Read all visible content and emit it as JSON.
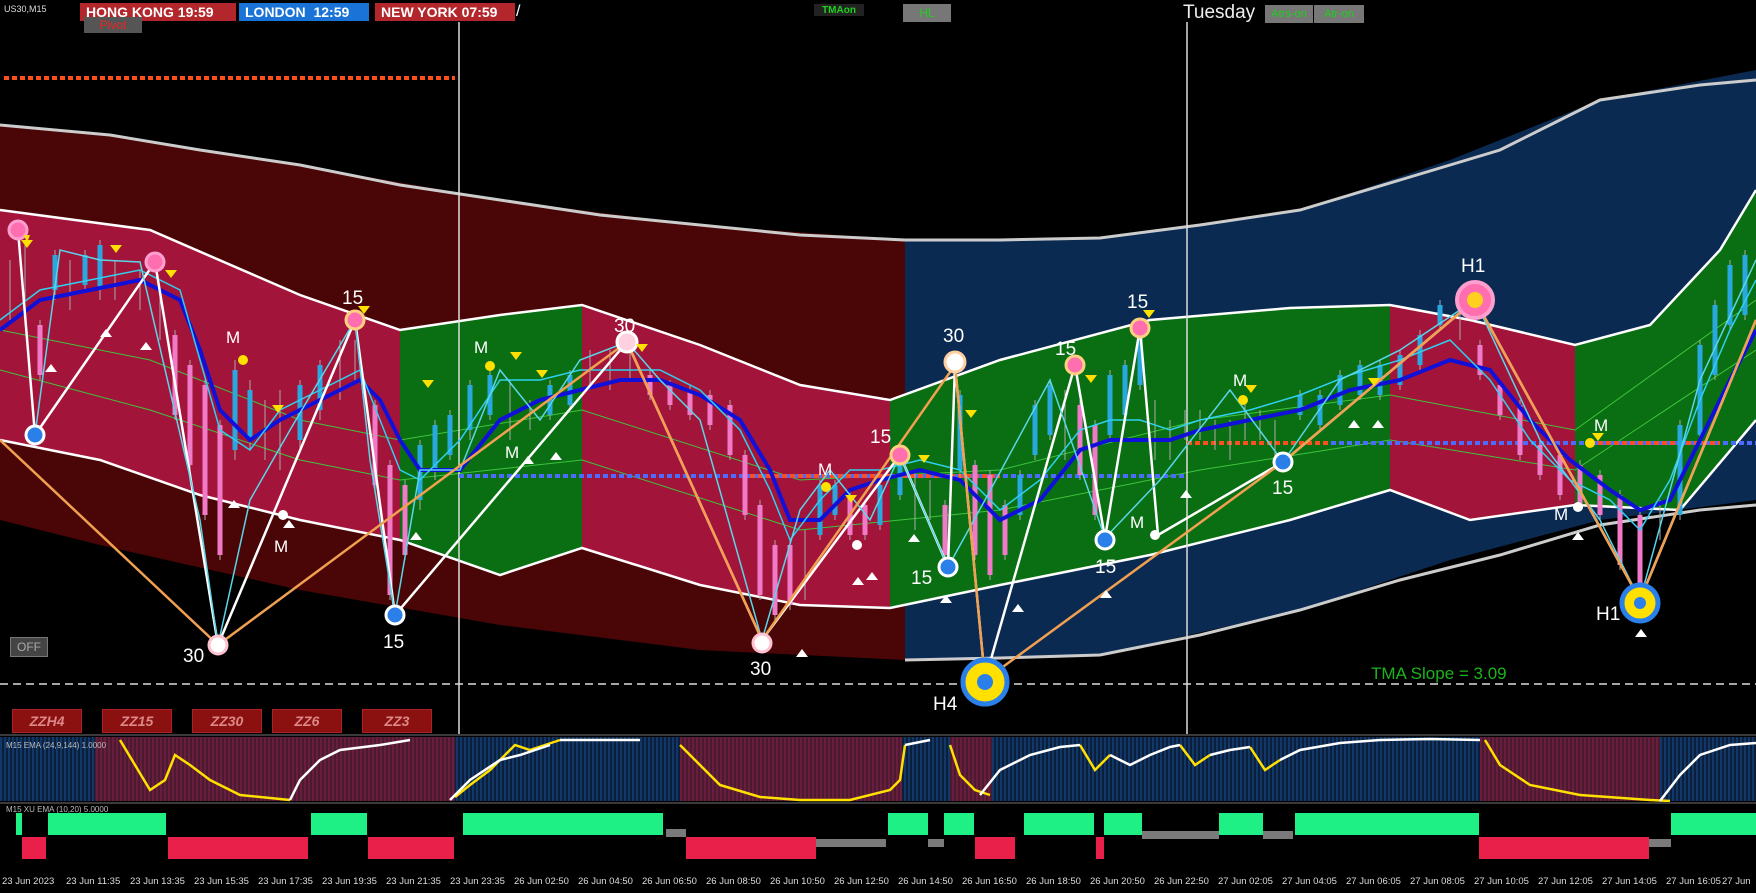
{
  "symbol": "US30,M15",
  "clocks": [
    {
      "city": "HONG KONG",
      "time": "19:59",
      "color": "#b3262b"
    },
    {
      "city": "LONDON",
      "time": "12:59",
      "color": "#1a73d6"
    },
    {
      "city": "NEW YORK",
      "time": "07:59",
      "color": "#b3262b"
    }
  ],
  "toolbar": {
    "pivot_label": "Pivot",
    "tma_on_label": "TMAon",
    "hl_label": "HL",
    "day_label": "Tuesday",
    "atrs_on_label": "Atrs-on",
    "atr_on_label": "Atr-on",
    "off_label": "OFF"
  },
  "zz_buttons": [
    "ZZH4",
    "ZZ15",
    "ZZ30",
    "ZZ6",
    "ZZ3"
  ],
  "tma_slope": "TMA Slope = 3.09",
  "zigzag_labels": {
    "fifteen": "15",
    "thirty": "30",
    "m": "M",
    "h1": "H1",
    "h4": "H4"
  },
  "pane1_label": "M15 EMA (24,9,144) 1.0000",
  "pane2_label": "M15 XU EMA (10,20) 5.0000",
  "time_axis": [
    "23 Jun 2023",
    "23 Jun 11:35",
    "23 Jun 13:35",
    "23 Jun 15:35",
    "23 Jun 17:35",
    "23 Jun 19:35",
    "23 Jun 21:35",
    "23 Jun 23:35",
    "26 Jun 02:50",
    "26 Jun 04:50",
    "26 Jun 06:50",
    "26 Jun 08:50",
    "26 Jun 10:50",
    "26 Jun 12:50",
    "26 Jun 14:50",
    "26 Jun 16:50",
    "26 Jun 18:50",
    "26 Jun 20:50",
    "26 Jun 22:50",
    "27 Jun 02:05",
    "27 Jun 04:05",
    "27 Jun 06:05",
    "27 Jun 08:05",
    "27 Jun 10:05",
    "27 Jun 12:05",
    "27 Jun 14:05",
    "27 Jun 16:05",
    "27 Jun"
  ],
  "colors": {
    "band_red_dark": "#4a0606",
    "band_red": "#a3143a",
    "band_green": "#0a6e12",
    "band_blue": "#0b2a52",
    "tma_line": "#1010d8",
    "zigzag_white": "#ffffff",
    "zigzag_orange": "#f0a050",
    "candle_up": "#29a8e0",
    "candle_down": "#f07ac8",
    "slope_text": "#1ab51a"
  }
}
